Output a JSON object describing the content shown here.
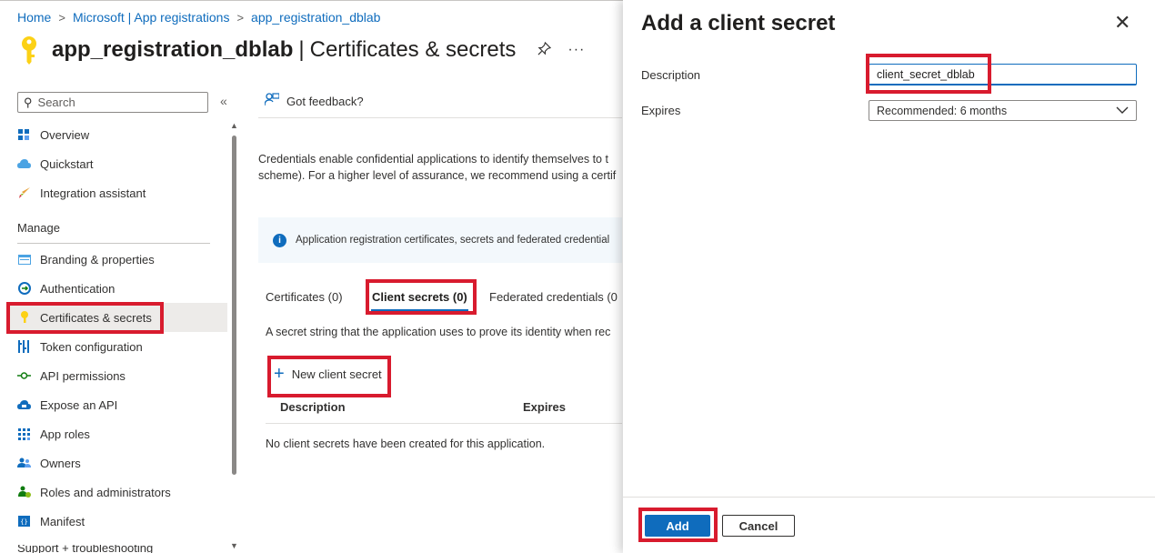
{
  "breadcrumb": {
    "items": [
      "Home",
      "Microsoft | App registrations",
      "app_registration_dblab"
    ],
    "separator": ">"
  },
  "header": {
    "title": "app_registration_dblab",
    "separator": "|",
    "subtitle": "Certificates & secrets",
    "icon": "key-icon",
    "more": "···"
  },
  "sidebar": {
    "search_placeholder": "Search",
    "collapse": "«",
    "section_manage": "Manage",
    "items": [
      {
        "label": "Overview",
        "icon": "overview-icon"
      },
      {
        "label": "Quickstart",
        "icon": "cloud-icon"
      },
      {
        "label": "Integration assistant",
        "icon": "rocket-icon"
      },
      {
        "label": "Branding & properties",
        "icon": "branding-icon"
      },
      {
        "label": "Authentication",
        "icon": "authentication-icon"
      },
      {
        "label": "Certificates & secrets",
        "icon": "key-icon",
        "selected": true
      },
      {
        "label": "Token configuration",
        "icon": "token-icon"
      },
      {
        "label": "API permissions",
        "icon": "api-permissions-icon"
      },
      {
        "label": "Expose an API",
        "icon": "cloud-api-icon"
      },
      {
        "label": "App roles",
        "icon": "app-roles-icon"
      },
      {
        "label": "Owners",
        "icon": "owners-icon"
      },
      {
        "label": "Roles and administrators",
        "icon": "roles-icon"
      },
      {
        "label": "Manifest",
        "icon": "manifest-icon"
      }
    ],
    "cut_item": "Support + troubleshooting"
  },
  "main": {
    "feedback": "Got feedback?",
    "description_line1": "Credentials enable confidential applications to identify themselves to t",
    "description_line2": "scheme). For a higher level of assurance, we recommend using a certif",
    "info_text": "Application registration certificates, secrets and federated credential",
    "tabs": [
      {
        "label": "Certificates (0)"
      },
      {
        "label": "Client secrets (0)",
        "active": true
      },
      {
        "label": "Federated credentials (0"
      }
    ],
    "secret_description": "A secret string that the application uses to prove its identity when rec",
    "new_secret_label": "New client secret",
    "table_headers": [
      "Description",
      "Expires"
    ],
    "empty_message": "No client secrets have been created for this application."
  },
  "panel": {
    "title": "Add a client secret",
    "close": "✕",
    "description_label": "Description",
    "description_value": "client_secret_dblab",
    "expires_label": "Expires",
    "expires_value": "Recommended: 6 months",
    "add_label": "Add",
    "cancel_label": "Cancel"
  },
  "colors": {
    "accent": "#0f6cbd",
    "highlight": "#d81b2e",
    "selected_bg": "#edebe9",
    "info_bg": "#f3f8fc"
  }
}
